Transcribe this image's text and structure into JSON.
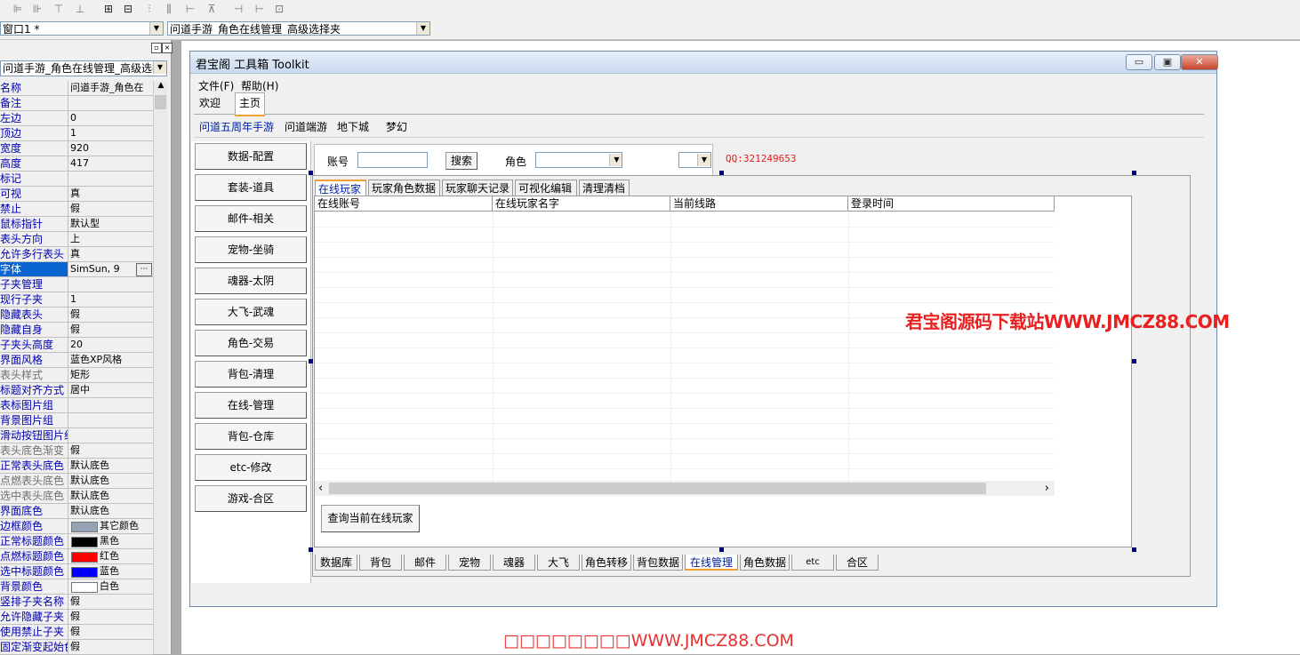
{
  "toolbar": {
    "icons": [
      "align-left-icon",
      "align-center-icon",
      "align-top-icon",
      "align-bottom-icon",
      "same-width-icon",
      "same-height-icon",
      "center-horizontal-icon",
      "space-evenly-icon",
      "space-vertical-icon",
      "distribute-icon",
      "grid-icon"
    ]
  },
  "selectors": {
    "object_combo": "窗口1 *",
    "event_combo": "问道手游_角色在线管理_高级选择夹"
  },
  "property_panel": {
    "object_select": "问道手游_角色在线管理_高级选择夹",
    "rows": [
      {
        "name": "名称",
        "value": "问道手游_角色在"
      },
      {
        "name": "备注",
        "value": ""
      },
      {
        "name": "左边",
        "value": "0"
      },
      {
        "name": "顶边",
        "value": "1"
      },
      {
        "name": "宽度",
        "value": "920"
      },
      {
        "name": "高度",
        "value": "417"
      },
      {
        "name": "标记",
        "value": ""
      },
      {
        "name": "可视",
        "value": "真"
      },
      {
        "name": "禁止",
        "value": "假"
      },
      {
        "name": "鼠标指针",
        "value": "默认型"
      },
      {
        "name": "表头方向",
        "value": "上"
      },
      {
        "name": "允许多行表头",
        "value": "真"
      },
      {
        "name": "字体",
        "value": "SimSun, 9"
      },
      {
        "name": "子夹管理",
        "value": ""
      },
      {
        "name": "现行子夹",
        "value": "1"
      },
      {
        "name": "隐藏表头",
        "value": "假"
      },
      {
        "name": "隐藏自身",
        "value": "假"
      },
      {
        "name": "子夹头高度",
        "value": "20"
      },
      {
        "name": "界面风格",
        "value": "蓝色XP风格"
      },
      {
        "name": "表头样式",
        "value": "矩形"
      },
      {
        "name": "标题对齐方式",
        "value": "居中"
      },
      {
        "name": "表标图片组",
        "value": ""
      },
      {
        "name": "背景图片组",
        "value": ""
      },
      {
        "name": "滑动按钮图片组",
        "value": ""
      },
      {
        "name": "表头底色渐变",
        "value": "假"
      },
      {
        "name": "正常表头底色",
        "value": "默认底色"
      },
      {
        "name": "点燃表头底色",
        "value": "默认底色"
      },
      {
        "name": "选中表头底色",
        "value": "默认底色"
      },
      {
        "name": "界面底色",
        "value": "默认底色"
      },
      {
        "name": "边框颜色",
        "value": "其它颜色",
        "color": "#94a3b3"
      },
      {
        "name": "正常标题颜色",
        "value": "黑色",
        "color": "#000000"
      },
      {
        "name": "点燃标题颜色",
        "value": "红色",
        "color": "#ff0000"
      },
      {
        "name": "选中标题颜色",
        "value": "蓝色",
        "color": "#0000ff"
      },
      {
        "name": "背景颜色",
        "value": "白色",
        "color": "#ffffff"
      },
      {
        "name": "竖排子夹名称",
        "value": "假"
      },
      {
        "name": "允许隐藏子夹",
        "value": "假"
      },
      {
        "name": "使用禁止子夹",
        "value": "假"
      },
      {
        "name": "固定渐变起始色",
        "value": "假"
      }
    ]
  },
  "window": {
    "title": "君宝阁 工具箱 Toolkit",
    "minimize": "▭",
    "maximize": "▣",
    "close": "✕",
    "menu": [
      "文件(F)",
      "帮助(H)"
    ],
    "top_tabs": [
      "欢迎",
      "主页"
    ],
    "game_tabs": [
      "问道五周年手游",
      "问道端游",
      "地下城",
      "梦幻"
    ],
    "left_buttons": [
      "数据-配置",
      "套装-道具",
      "邮件-相关",
      "宠物-坐骑",
      "魂器-太阴",
      "大飞-武魂",
      "角色-交易",
      "背包-清理",
      "在线-管理",
      "背包-仓库",
      "etc-修改",
      "游戏-合区"
    ],
    "search": {
      "account_label": "账号",
      "search_button": "搜索",
      "role_label": "角色",
      "qq": "QQ:321249653"
    },
    "inner_tabs": [
      "在线玩家",
      "玩家角色数据",
      "玩家聊天记录",
      "可视化编辑",
      "清理清档"
    ],
    "columns": [
      "在线账号",
      "在线玩家名字",
      "当前线路",
      "登录时间"
    ],
    "scroll_left": "‹",
    "scroll_right": "›",
    "query_button": "查询当前在线玩家",
    "bottom_tabs": [
      "数据库",
      "背包",
      "邮件",
      "宠物",
      "魂器",
      "大飞",
      "角色转移",
      "背包数据",
      "在线管理",
      "角色数据",
      "etc",
      "合区"
    ]
  },
  "watermark": "君宝阁源码下载站WWW.JMCZ88.COM",
  "footer_watermark": "□□□□□□□□WWW.JMCZ88.COM"
}
